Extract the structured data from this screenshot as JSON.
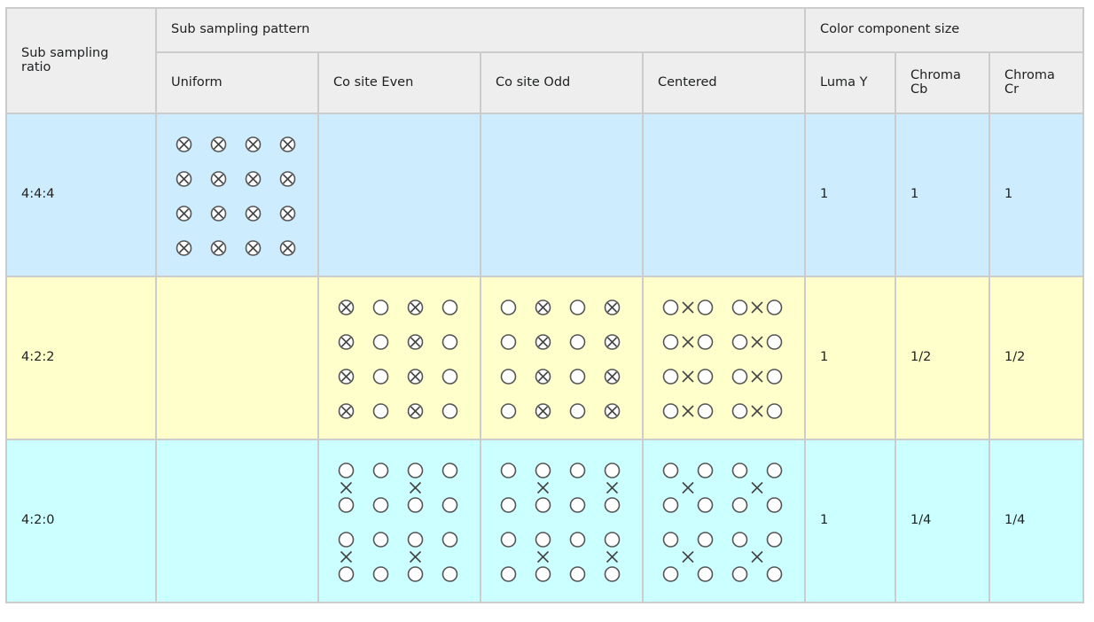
{
  "headers": {
    "ratio": "Sub sampling ratio",
    "pattern_group": "Sub sampling pattern",
    "size_group": "Color component size",
    "uniform": "Uniform",
    "cosite_even": "Co site Even",
    "cosite_odd": "Co site Odd",
    "centered": "Centered",
    "luma": "Luma Y",
    "chroma_cb": "Chroma Cb",
    "chroma_cr": "Chroma Cr"
  },
  "legend_symbols": {
    "X": "circled-x (luma+chroma sample)",
    "O": "circle (luma sample)",
    "x": "cross (chroma sample)"
  },
  "colors": {
    "row_444": "#cdecfe",
    "row_422": "#ffffcc",
    "row_420": "#ccffff",
    "header": "#eeeeee"
  },
  "rows": [
    {
      "ratio": "4:4:4",
      "patterns": {
        "uniform": [
          "X.X.X.X",
          ".......",
          "X.X.X.X",
          ".......",
          "X.X.X.X",
          ".......",
          "X.X.X.X"
        ],
        "cosite_even": null,
        "cosite_odd": null,
        "centered": null
      },
      "luma": "1",
      "cb": "1",
      "cr": "1"
    },
    {
      "ratio": "4:2:2",
      "patterns": {
        "uniform": null,
        "cosite_even": [
          "X.O.X.O",
          ".......",
          "X.O.X.O",
          ".......",
          "X.O.X.O",
          ".......",
          "X.O.X.O"
        ],
        "cosite_odd": [
          "O.X.O.X",
          ".......",
          "O.X.O.X",
          ".......",
          "O.X.O.X",
          ".......",
          "O.X.O.X"
        ],
        "centered": [
          "OxO.OxO",
          ".......",
          "OxO.OxO",
          ".......",
          "OxO.OxO",
          ".......",
          "OxO.OxO"
        ]
      },
      "luma": "1",
      "cb": "1/2",
      "cr": "1/2"
    },
    {
      "ratio": "4:2:0",
      "patterns": {
        "uniform": null,
        "cosite_even": [
          "O.O.O.O",
          "x...x..",
          "O.O.O.O",
          ".......",
          "O.O.O.O",
          "x...x..",
          "O.O.O.O"
        ],
        "cosite_odd": [
          "O.O.O.O",
          "..x...x",
          "O.O.O.O",
          ".......",
          "O.O.O.O",
          "..x...x",
          "O.O.O.O"
        ],
        "centered": [
          "O.O.O.O",
          ".x...x.",
          "O.O.O.O",
          ".......",
          "O.O.O.O",
          ".x...x.",
          "O.O.O.O"
        ]
      },
      "luma": "1",
      "cb": "1/4",
      "cr": "1/4"
    }
  ]
}
